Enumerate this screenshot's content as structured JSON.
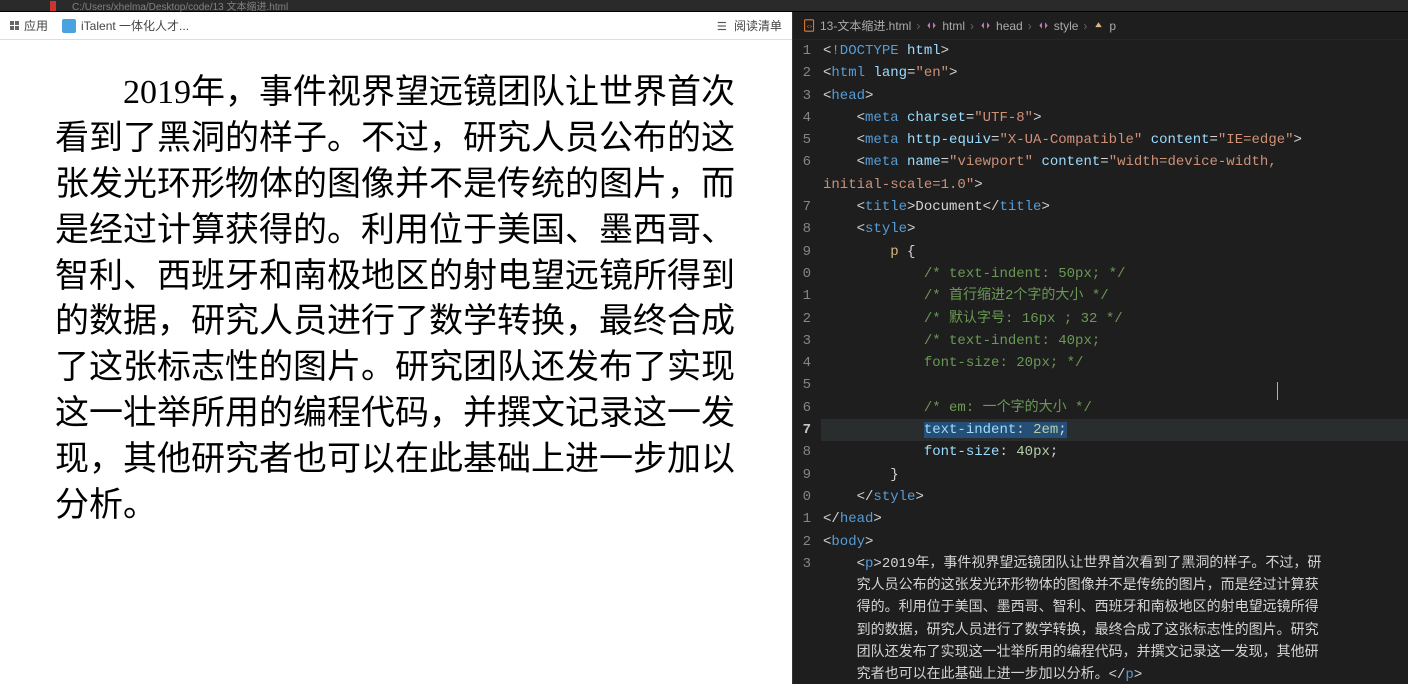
{
  "topbar": {
    "title_fragment": "C:/Users/xhelma/Desktop/code/13 文本缩进.html"
  },
  "bookmarks": {
    "apps_label": "应用",
    "italent_label": "iTalent 一体化人才...",
    "reading_list_label": "阅读清单"
  },
  "browser": {
    "paragraph": "2019年，事件视界望远镜团队让世界首次看到了黑洞的样子。不过，研究人员公布的这张发光环形物体的图像并不是传统的图片，而是经过计算获得的。利用位于美国、墨西哥、智利、西班牙和南极地区的射电望远镜所得到的数据，研究人员进行了数学转换，最终合成了这张标志性的图片。研究团队还发布了实现这一壮举所用的编程代码，并撰文记录这一发现，其他研究者也可以在此基础上进一步加以分析。"
  },
  "breadcrumb": {
    "file": "13-文本缩进.html",
    "parts": [
      "html",
      "head",
      "style",
      "p"
    ]
  },
  "code": {
    "lines": [
      {
        "n": "1",
        "html": "&lt;<s class='tok-doctype'>!DOCTYPE</s> <s class='tok-attr'>html</s>&gt;"
      },
      {
        "n": "2",
        "html": "&lt;<s class='tok-tag'>html</s> <s class='tok-attr'>lang</s>=<s class='tok-string'>\"en\"</s>&gt;"
      },
      {
        "n": "3",
        "html": "&lt;<s class='tok-tag'>head</s>&gt;"
      },
      {
        "n": "4",
        "html": "    &lt;<s class='tok-tag'>meta</s> <s class='tok-attr'>charset</s>=<s class='tok-string'>\"UTF-8\"</s>&gt;"
      },
      {
        "n": "5",
        "html": "    &lt;<s class='tok-tag'>meta</s> <s class='tok-attr'>http-equiv</s>=<s class='tok-string'>\"X-UA-Compatible\"</s> <s class='tok-attr'>content</s>=<s class='tok-string'>\"IE=edge\"</s>&gt;"
      },
      {
        "n": "6",
        "html": "    &lt;<s class='tok-tag'>meta</s> <s class='tok-attr'>name</s>=<s class='tok-string'>\"viewport\"</s> <s class='tok-attr'>content</s>=<s class='tok-string'>\"width=device-width, </s>"
      },
      {
        "n": "",
        "html": "<s class='tok-string'>initial-scale=1.0\"</s>&gt;"
      },
      {
        "n": "7",
        "html": "    &lt;<s class='tok-tag'>title</s>&gt;Document&lt;/<s class='tok-tag'>title</s>&gt;"
      },
      {
        "n": "8",
        "html": "    &lt;<s class='tok-tag'>style</s>&gt;"
      },
      {
        "n": "9",
        "html": "        <s class='tok-selector'>p</s> <s class='tok-punct'>{</s>"
      },
      {
        "n": "0",
        "html": "            <s class='tok-comment'>/* text-indent: 50px; */</s>"
      },
      {
        "n": "1",
        "html": "            <s class='tok-comment'>/* 首行缩进2个字的大小 */</s>"
      },
      {
        "n": "2",
        "html": "            <s class='tok-comment'>/* 默认字号: 16px ; 32 */</s>"
      },
      {
        "n": "3",
        "html": "            <s class='tok-comment'>/* text-indent: 40px;</s>"
      },
      {
        "n": "4",
        "html": "            <s class='tok-comment'>font-size: 20px; */</s>"
      },
      {
        "n": "5",
        "html": ""
      },
      {
        "n": "6",
        "html": "            <s class='tok-comment'>/* em: 一个字的大小 */</s>"
      },
      {
        "n": "7",
        "html": "            <s class='highlight-sel'><s class='tok-prop'>text-indent</s><s class='tok-punct'>:</s> <s class='tok-num'>2em</s><s class='tok-punct'>;</s></s>",
        "hl": true
      },
      {
        "n": "8",
        "html": "            <s class='tok-prop'>font-size</s><s class='tok-punct'>:</s> <s class='tok-num'>40px</s><s class='tok-punct'>;</s>"
      },
      {
        "n": "9",
        "html": "        <s class='tok-punct'>}</s>"
      },
      {
        "n": "0",
        "html": "    &lt;/<s class='tok-tag'>style</s>&gt;"
      },
      {
        "n": "1",
        "html": "&lt;/<s class='tok-tag'>head</s>&gt;"
      },
      {
        "n": "2",
        "html": "&lt;<s class='tok-tag'>body</s>&gt;"
      },
      {
        "n": "3",
        "html": "    &lt;<s class='tok-tag'>p</s>&gt;2019年，事件视界望远镜团队让世界首次看到了黑洞的样子。不过，研"
      },
      {
        "n": "",
        "html": "    究人员公布的这张发光环形物体的图像并不是传统的图片，而是经过计算获"
      },
      {
        "n": "",
        "html": "    得的。利用位于美国、墨西哥、智利、西班牙和南极地区的射电望远镜所得"
      },
      {
        "n": "",
        "html": "    到的数据，研究人员进行了数学转换，最终合成了这张标志性的图片。研究"
      },
      {
        "n": "",
        "html": "    团队还发布了实现这一壮举所用的编程代码，并撰文记录这一发现，其他研"
      },
      {
        "n": "",
        "html": "    究者也可以在此基础上进一步加以分析。&lt;/<s class='tok-tag'>p</s>&gt;"
      }
    ]
  }
}
